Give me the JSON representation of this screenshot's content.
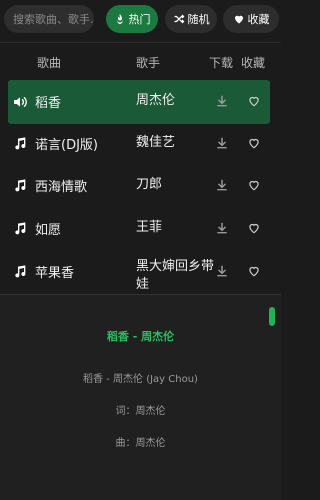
{
  "search": {
    "placeholder": "搜索歌曲、歌手..."
  },
  "tabs": [
    {
      "label": "热门",
      "active": true
    },
    {
      "label": "随机",
      "active": false
    },
    {
      "label": "收藏",
      "active": false
    }
  ],
  "table_headers": {
    "song": "歌曲",
    "artist": "歌手",
    "download": "下载",
    "favorite": "收藏"
  },
  "songs": [
    {
      "title": "稻香",
      "artist": "周杰伦",
      "playing": true
    },
    {
      "title": "诺言(DJ版)",
      "artist": "魏佳艺",
      "playing": false
    },
    {
      "title": "西海情歌",
      "artist": "刀郎",
      "playing": false
    },
    {
      "title": "如愿",
      "artist": "王菲",
      "playing": false
    },
    {
      "title": "苹果香",
      "artist": "黑大婶回乡带娃",
      "playing": false
    }
  ],
  "lyrics": {
    "title": "稻香 - 周杰伦",
    "lines": [
      "稻香 - 周杰伦 (Jay Chou)",
      "词：周杰伦",
      "曲：周杰伦"
    ]
  },
  "colors": {
    "accent": "#1a7a3f",
    "active_row": "#1a5a36",
    "background": "#1b1b1b"
  }
}
